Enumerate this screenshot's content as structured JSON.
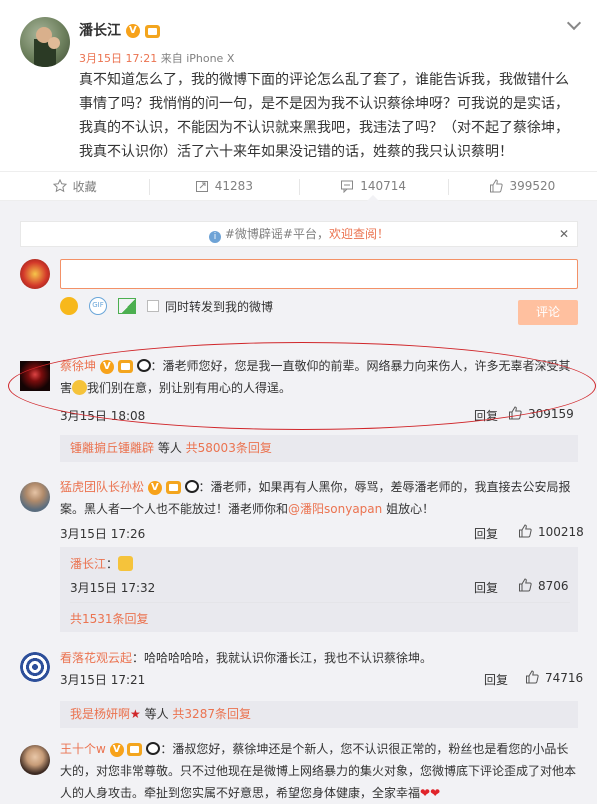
{
  "post": {
    "author": "潘长江",
    "time": "3月15日 17:21",
    "source": "来自 iPhone X",
    "text": "真不知道怎么了，我的微博下面的评论怎么乱了套了，谁能告诉我，我做错什么事情了吗？我悄悄的问一句，是不是因为我不认识蔡徐坤呀？可我说的是实话，我真的不认识，不能因为不认识就来黑我吧，我违法了吗？（对不起了蔡徐坤，我真不认识你）活了六十来年如果没记错的话，姓蔡的我只认识蔡明！"
  },
  "actions": {
    "collect": "收藏",
    "repost": "41283",
    "comment": "140714",
    "like": "399520"
  },
  "notice": {
    "pre": "#微博辟谣#平台，",
    "link": "欢迎查阅！"
  },
  "composer": {
    "sync_label": "同时转发到我的微博",
    "submit": "评论"
  },
  "comments": [
    {
      "name": "蔡徐坤",
      "sep": "：",
      "text": "潘老师您好，您是我一直敬仰的前辈。网络暴力向来伤人，许多无辜者深受其害",
      "text2": "我们别在意，别让别有用心的人得逞。",
      "time": "3月15日 18:08",
      "reply": "回复",
      "likes": "309159",
      "sub": {
        "a": "锺離掮丘锺離辟",
        "b": " 等人 ",
        "c": "共58003条回复"
      }
    },
    {
      "name": "猛虎团队长孙松",
      "sep": "：",
      "text": "潘老师，如果再有人黑你，辱骂，差辱潘老师的，我直接去公安局报案。黑人者一个人也不能放过！潘老师你和",
      "mention": "@潘阳sonyapan",
      "text2": " 姐放心！",
      "time": "3月15日 17:26",
      "reply": "回复",
      "likes": "100218",
      "reply_item": {
        "name": "潘长江",
        "sep": "：",
        "time": "3月15日 17:32",
        "reply": "回复",
        "likes": "8706"
      },
      "sub": {
        "c": "共1531条回复"
      }
    },
    {
      "name": "看落花观云起",
      "sep": "：",
      "text": "哈哈哈哈哈，我就认识你潘长江，我也不认识蔡徐坤。",
      "time": "3月15日 17:21",
      "reply": "回复",
      "likes": "74716",
      "sub": {
        "a": "我是杨妍啊",
        "b": " 等人 ",
        "c": "共3287条回复"
      }
    },
    {
      "name": "王十个w",
      "sep": "：",
      "text": "潘叔您好，蔡徐坤还是个新人，您不认识很正常的，粉丝也是看您的小品长大的，对您非常尊敬。只不过他现在是微博上网络暴力的集火对象，您微博底下评论歪成了对他本人的人身攻击。牵扯到您实属不好意思，希望您身体健康，全家幸福"
    }
  ],
  "colors": {
    "accent": "#eb7350",
    "bg": "#f2f2f5",
    "annotation": "#d0262a"
  }
}
